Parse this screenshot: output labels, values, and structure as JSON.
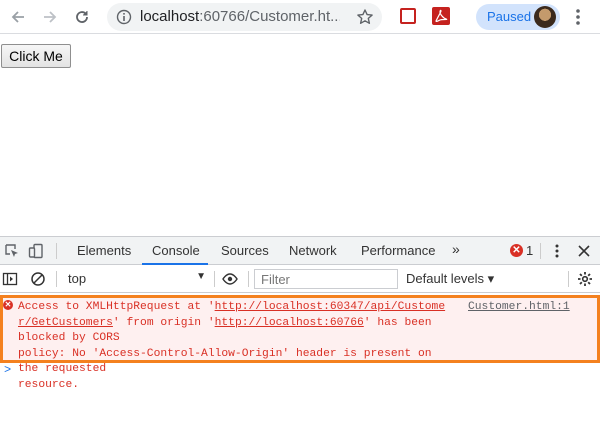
{
  "browser": {
    "url_host": "localhost",
    "url_rest": ":60766/Customer.ht...",
    "profile_label": "Paused",
    "icons": [
      "back-arrow-icon",
      "forward-arrow-icon",
      "reload-icon",
      "info-icon",
      "star-icon",
      "pocket-icon",
      "pdf-icon",
      "avatar",
      "more-icon"
    ]
  },
  "page": {
    "button_label": "Click Me"
  },
  "devtools": {
    "tabs": [
      {
        "label": "Elements"
      },
      {
        "label": "Console",
        "active": true
      },
      {
        "label": "Sources"
      },
      {
        "label": "Network"
      },
      {
        "label": "Performance"
      }
    ],
    "more_tabs": "»",
    "error_count": "1",
    "context": "top",
    "filter_placeholder": "Filter",
    "levels": "Default levels ▾",
    "console": {
      "error": {
        "line1_a": "Access to XMLHttpRequest at '",
        "line1_link": "http://localhost:60347/api/Custome",
        "line2_link": "r/GetCustomers",
        "line2_b": "' from origin '",
        "line2_link2": "http://localhost:60766",
        "line2_c": "' has been blocked by CORS",
        "line3": "policy: No 'Access-Control-Allow-Origin' header is present on the requested",
        "line4": "resource.",
        "source_line1": "Customer.html:1",
        "source_line2": ""
      },
      "prompt": ">"
    },
    "colors": {
      "error_text": "#d93025",
      "error_bg": "#fef0f0",
      "highlight_border": "#f4811f",
      "active_tab": "#1a73e8"
    }
  }
}
